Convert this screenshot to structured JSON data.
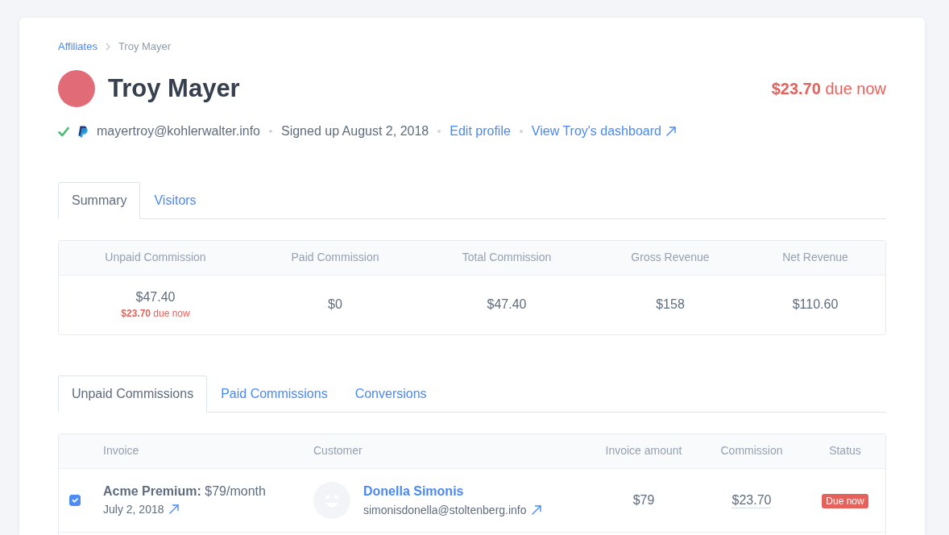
{
  "breadcrumb": [
    {
      "label": "Affiliates",
      "kind": "link"
    },
    {
      "label": "Troy Mayer",
      "kind": "current"
    }
  ],
  "header": {
    "name": "Troy Mayer",
    "due": "**$23.70** due now"
  },
  "meta": {
    "verified": true,
    "email": "mayertroy@kohlerwalter.info",
    "signed_up": "Signed up August 2, 2018",
    "links": [
      {
        "label": "Edit profile",
        "external": false
      },
      {
        "label": "View Troy's dashboard",
        "external": true
      }
    ]
  },
  "summary_tabs": [
    {
      "label": "Summary",
      "selected": true
    },
    {
      "label": "Visitors",
      "selected": false
    }
  ],
  "summary": [
    {
      "heading": "Unpaid Commission",
      "value": "$47.40",
      "note": "**$23.70** due now"
    },
    {
      "heading": "Paid Commission",
      "value": "$0"
    },
    {
      "heading": "Total Commission",
      "value": "$47.40"
    },
    {
      "heading": "Gross Revenue",
      "value": "$158"
    },
    {
      "heading": "Net Revenue",
      "value": "$110.60"
    }
  ],
  "commission_tabs": [
    {
      "label": "Unpaid Commissions",
      "selected": true
    },
    {
      "label": "Paid Commissions",
      "selected": false
    },
    {
      "label": "Conversions",
      "selected": false
    }
  ],
  "commissions_table": {
    "columns": [
      "Invoice",
      "Customer",
      "Invoice amount",
      "Commission",
      "Status"
    ],
    "rows": [
      {
        "checked": true,
        "plan": "**Acme Premium:** $79/month",
        "date": "July 2, 2018",
        "customer_name": "Donella Simonis",
        "customer_email": "simonisdonella@stoltenberg.info",
        "invoice_amount": "$79",
        "commission": "$23.70",
        "status": {
          "label": "Due now",
          "kind": "due_now"
        }
      }
    ]
  }
}
